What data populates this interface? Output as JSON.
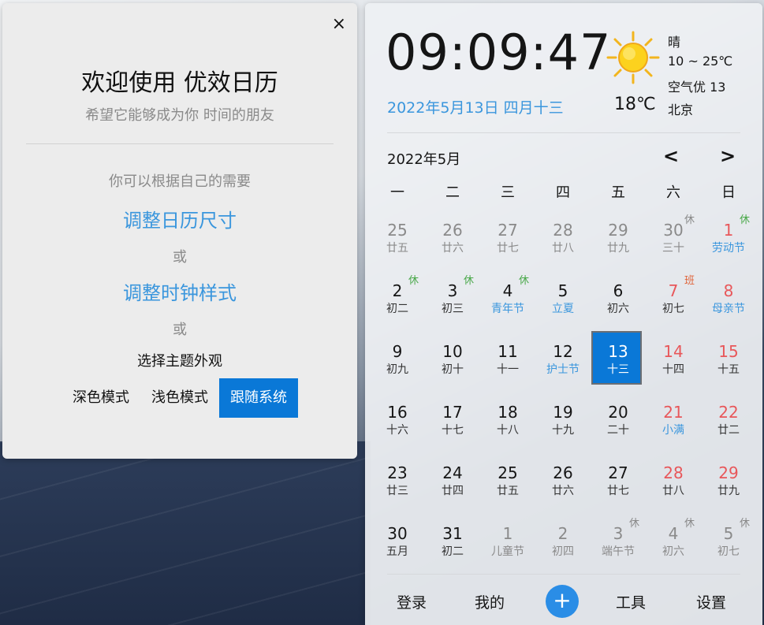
{
  "welcome": {
    "close_label": "×",
    "title": "欢迎使用 优效日历",
    "subtitle": "希望它能够成为你 时间的朋友",
    "hint": "你可以根据自己的需要",
    "link_size": "调整日历尺寸",
    "or1": "或",
    "link_clock": "调整时钟样式",
    "or2": "或",
    "theme_label": "选择主题外观",
    "modes": [
      "深色模式",
      "浅色模式",
      "跟随系统"
    ],
    "active_mode": "跟随系统"
  },
  "clock": {
    "time": "09:09:47",
    "date": "2022年5月13日 四月十三"
  },
  "weather": {
    "icon": "sun-icon",
    "temp": "18℃",
    "condition": "晴",
    "range": "10 ~ 25℃",
    "air": "空气优 13",
    "city": "北京"
  },
  "calendar": {
    "month_label": "2022年5月",
    "prev_label": "<",
    "next_label": ">",
    "weekdays": [
      "一",
      "二",
      "三",
      "四",
      "五",
      "六",
      "日"
    ],
    "days": [
      {
        "num": "25",
        "lunar": "廿五",
        "other": true
      },
      {
        "num": "26",
        "lunar": "廿六",
        "other": true
      },
      {
        "num": "27",
        "lunar": "廿七",
        "other": true
      },
      {
        "num": "28",
        "lunar": "廿八",
        "other": true
      },
      {
        "num": "29",
        "lunar": "廿九",
        "other": true
      },
      {
        "num": "30",
        "lunar": "三十",
        "other": true,
        "badge": "休",
        "badge_type": "grey"
      },
      {
        "num": "1",
        "lunar": "劳动节",
        "weekend": true,
        "festival": true,
        "badge": "休",
        "badge_type": "rest"
      },
      {
        "num": "2",
        "lunar": "初二",
        "badge": "休",
        "badge_type": "rest"
      },
      {
        "num": "3",
        "lunar": "初三",
        "badge": "休",
        "badge_type": "rest"
      },
      {
        "num": "4",
        "lunar": "青年节",
        "festival": true,
        "badge": "休",
        "badge_type": "rest"
      },
      {
        "num": "5",
        "lunar": "立夏",
        "festival": true
      },
      {
        "num": "6",
        "lunar": "初六"
      },
      {
        "num": "7",
        "lunar": "初七",
        "weekend": true,
        "badge": "班",
        "badge_type": "work"
      },
      {
        "num": "8",
        "lunar": "母亲节",
        "weekend": true,
        "festival": true
      },
      {
        "num": "9",
        "lunar": "初九"
      },
      {
        "num": "10",
        "lunar": "初十"
      },
      {
        "num": "11",
        "lunar": "十一"
      },
      {
        "num": "12",
        "lunar": "护士节",
        "festival": true
      },
      {
        "num": "13",
        "lunar": "十三",
        "today": true
      },
      {
        "num": "14",
        "lunar": "十四",
        "weekend": true
      },
      {
        "num": "15",
        "lunar": "十五",
        "weekend": true
      },
      {
        "num": "16",
        "lunar": "十六"
      },
      {
        "num": "17",
        "lunar": "十七"
      },
      {
        "num": "18",
        "lunar": "十八"
      },
      {
        "num": "19",
        "lunar": "十九"
      },
      {
        "num": "20",
        "lunar": "二十"
      },
      {
        "num": "21",
        "lunar": "小满",
        "weekend": true,
        "festival": true
      },
      {
        "num": "22",
        "lunar": "廿二",
        "weekend": true
      },
      {
        "num": "23",
        "lunar": "廿三"
      },
      {
        "num": "24",
        "lunar": "廿四"
      },
      {
        "num": "25",
        "lunar": "廿五"
      },
      {
        "num": "26",
        "lunar": "廿六"
      },
      {
        "num": "27",
        "lunar": "廿七"
      },
      {
        "num": "28",
        "lunar": "廿八",
        "weekend": true
      },
      {
        "num": "29",
        "lunar": "廿九",
        "weekend": true
      },
      {
        "num": "30",
        "lunar": "五月"
      },
      {
        "num": "31",
        "lunar": "初二"
      },
      {
        "num": "1",
        "lunar": "儿童节",
        "other": true
      },
      {
        "num": "2",
        "lunar": "初四",
        "other": true
      },
      {
        "num": "3",
        "lunar": "端午节",
        "other": true,
        "badge": "休",
        "badge_type": "grey"
      },
      {
        "num": "4",
        "lunar": "初六",
        "other": true,
        "badge": "休",
        "badge_type": "grey"
      },
      {
        "num": "5",
        "lunar": "初七",
        "other": true,
        "badge": "休",
        "badge_type": "grey"
      }
    ]
  },
  "footer": {
    "login": "登录",
    "mine": "我的",
    "add": "+",
    "tools": "工具",
    "settings": "设置"
  },
  "colors": {
    "accent": "#0a78d7",
    "link": "#3a96dd",
    "weekend": "#e8575a",
    "rest": "#4aa84a"
  }
}
